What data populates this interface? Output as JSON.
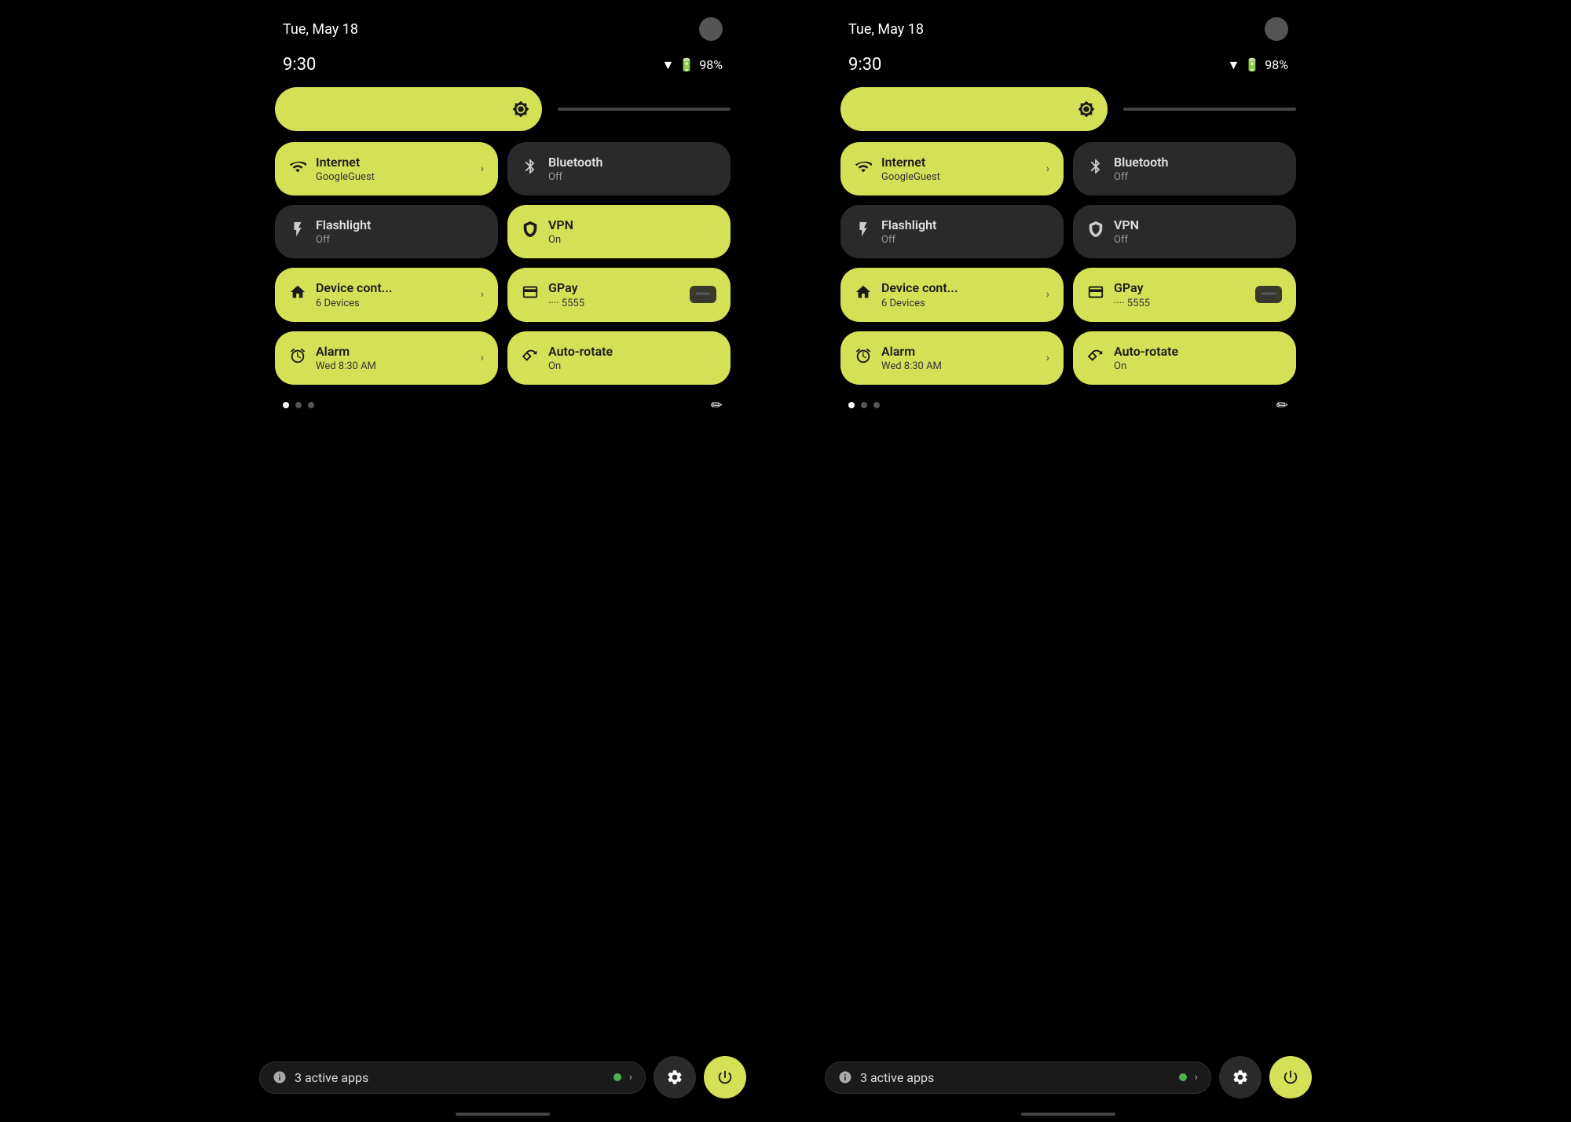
{
  "screens": [
    {
      "id": "screen-left",
      "statusBar": {
        "date": "Tue, May 18",
        "time": "9:30",
        "battery": "98%"
      },
      "brightness": {},
      "tiles": [
        {
          "id": "internet",
          "title": "Internet",
          "subtitle": "GoogleGuest",
          "state": "active",
          "icon": "wifi",
          "hasArrow": true
        },
        {
          "id": "bluetooth",
          "title": "Bluetooth",
          "subtitle": "Off",
          "state": "inactive",
          "icon": "bluetooth",
          "hasArrow": false
        },
        {
          "id": "flashlight",
          "title": "Flashlight",
          "subtitle": "Off",
          "state": "inactive",
          "icon": "flashlight",
          "hasArrow": false
        },
        {
          "id": "vpn",
          "title": "VPN",
          "subtitle": "On",
          "state": "active",
          "icon": "vpn",
          "hasArrow": false
        },
        {
          "id": "device-control",
          "title": "Device cont...",
          "subtitle": "6 Devices",
          "state": "active",
          "icon": "home",
          "hasArrow": true
        },
        {
          "id": "gpay",
          "title": "GPay",
          "subtitle": "···· 5555",
          "state": "active",
          "icon": "card",
          "hasCard": true
        },
        {
          "id": "alarm",
          "title": "Alarm",
          "subtitle": "Wed 8:30 AM",
          "state": "active",
          "icon": "alarm",
          "hasArrow": true
        },
        {
          "id": "autorotate",
          "title": "Auto-rotate",
          "subtitle": "On",
          "state": "active",
          "icon": "rotate",
          "hasArrow": false
        }
      ],
      "bottomBar": {
        "activeAppsCount": "3",
        "activeAppsLabel": "active apps"
      }
    },
    {
      "id": "screen-right",
      "statusBar": {
        "date": "Tue, May 18",
        "time": "9:30",
        "battery": "98%"
      },
      "brightness": {},
      "tiles": [
        {
          "id": "internet",
          "title": "Internet",
          "subtitle": "GoogleGuest",
          "state": "active",
          "icon": "wifi",
          "hasArrow": true
        },
        {
          "id": "bluetooth",
          "title": "Bluetooth",
          "subtitle": "Off",
          "state": "inactive",
          "icon": "bluetooth",
          "hasArrow": false
        },
        {
          "id": "flashlight",
          "title": "Flashlight",
          "subtitle": "Off",
          "state": "inactive",
          "icon": "flashlight",
          "hasArrow": false
        },
        {
          "id": "vpn",
          "title": "VPN",
          "subtitle": "Off",
          "state": "inactive",
          "icon": "vpn",
          "hasArrow": false
        },
        {
          "id": "device-control",
          "title": "Device cont...",
          "subtitle": "6 Devices",
          "state": "active",
          "icon": "home",
          "hasArrow": true
        },
        {
          "id": "gpay",
          "title": "GPay",
          "subtitle": "···· 5555",
          "state": "active",
          "icon": "card",
          "hasCard": true
        },
        {
          "id": "alarm",
          "title": "Alarm",
          "subtitle": "Wed 8:30 AM",
          "state": "active",
          "icon": "alarm",
          "hasArrow": true
        },
        {
          "id": "autorotate",
          "title": "Auto-rotate",
          "subtitle": "On",
          "state": "active",
          "icon": "rotate",
          "hasArrow": false
        }
      ],
      "bottomBar": {
        "activeAppsCount": "3",
        "activeAppsLabel": "active apps"
      }
    }
  ],
  "colors": {
    "active": "#d4e157",
    "inactive": "#2a2a2a",
    "background": "#000000"
  }
}
